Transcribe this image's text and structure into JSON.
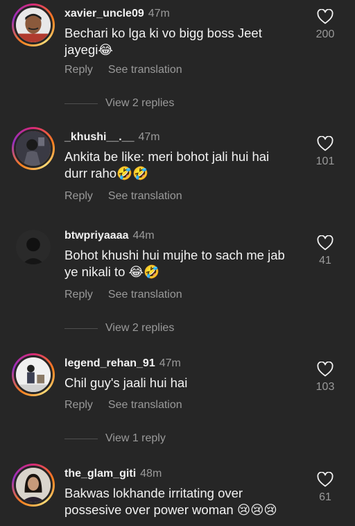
{
  "comments": [
    {
      "username": "xavier_uncle09",
      "time": "47m",
      "text": "Bechari ko lga ki vo bigg boss Jeet",
      "text2": "jayegi😂",
      "likes": "200",
      "reply_label": "Reply",
      "translate_label": "See translation",
      "view_replies": "View 2 replies",
      "avatar_ring": true
    },
    {
      "username": "_khushi__.__",
      "time": "47m",
      "text": "Ankita be like: meri bohot jali hui hai",
      "text2": "durr raho🤣🤣",
      "likes": "101",
      "reply_label": "Reply",
      "translate_label": "See translation",
      "avatar_ring": true
    },
    {
      "username": "btwpriyaaaa",
      "time": "44m",
      "text": "Bohot khushi hui mujhe to sach me jab",
      "text2": "ye nikali to 😂🤣",
      "likes": "41",
      "reply_label": "Reply",
      "translate_label": "See translation",
      "view_replies": "View 2 replies",
      "avatar_ring": false
    },
    {
      "username": "legend_rehan_91",
      "time": "47m",
      "text": "Chil guy's jaali hui hai",
      "likes": "103",
      "reply_label": "Reply",
      "translate_label": "See translation",
      "view_replies": "View 1 reply",
      "avatar_ring": true
    },
    {
      "username": "the_glam_giti",
      "time": "48m",
      "text": "Bakwas lokhande irritating over",
      "text2": "possesive over power woman 😢😢😢",
      "likes": "61",
      "avatar_ring": true
    }
  ],
  "icons": {
    "like": "heart-outline-icon"
  },
  "colors": {
    "background": "#262626",
    "primary_text": "#f2f2f2",
    "secondary_text": "#9a9a9a"
  }
}
